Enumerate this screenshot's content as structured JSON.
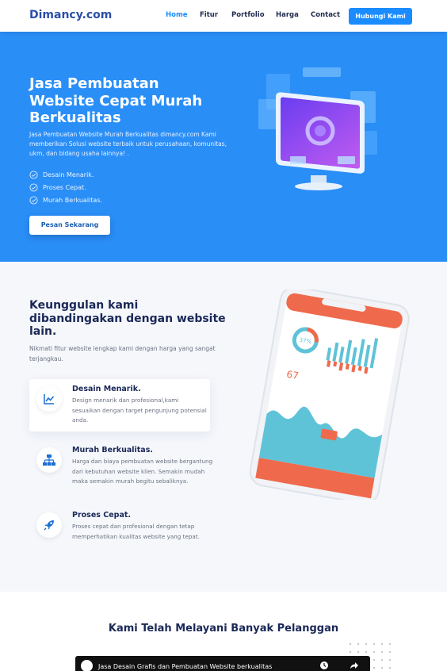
{
  "nav": {
    "brand": "Dimancy.com",
    "items": [
      {
        "label": "Home",
        "active": true
      },
      {
        "label": "Fitur",
        "active": false
      },
      {
        "label": "Portfolio",
        "active": false
      },
      {
        "label": "Harga",
        "active": false
      },
      {
        "label": "Contact",
        "active": false
      }
    ],
    "cta": "Hubungi Kami"
  },
  "hero": {
    "title": "Jasa Pembuatan Website Cepat Murah Berkualitas",
    "description": "Jasa Pembuatan Website Murah Berkualitas dimancy.com Kami memberikan Solusi website terbaik untuk perusahaan, komunitas, ukm, dan bidang usaha lainnya! .",
    "checks": [
      "Desain Menarik.",
      "Proses Cepat.",
      "Murah Berkualitas."
    ],
    "button": "Pesan Sekarang"
  },
  "features": {
    "title": "Keunggulan kami dibandingakan dengan website lain.",
    "subtitle": "Nikmati fitur website lengkap kami dengan harga yang sangat terjangkau.",
    "cards": [
      {
        "title": "Desain Menarik.",
        "text": "Design menarik dan profesional,kami sesuaikan dengan target pengunjung potensial anda.",
        "icon": "chart-line-icon"
      },
      {
        "title": "Murah Berkualitas.",
        "text": "Harga dan biaya pembuatan website bergantung dari kebutuhan website klien. Semakin mudah maka semakin murah begitu sebaliknya.",
        "icon": "sitemap-icon"
      },
      {
        "title": "Proses Cepat.",
        "text": "Proses cepat dan profesional dengan tetap memperhatikan kualitas website yang tepat.",
        "icon": "rocket-icon"
      }
    ]
  },
  "customers": {
    "title": "Kami Telah Melayani Banyak Pelanggan",
    "video_title": "Jasa Desain Grafis dan Pembuatan Website berkualitas"
  },
  "colors": {
    "accent": "#1a8cff",
    "hero_bg": "#2a8ef7",
    "heading": "#1a2857",
    "phone_orange": "#ef6a4c",
    "phone_teal": "#5fc3d8"
  }
}
